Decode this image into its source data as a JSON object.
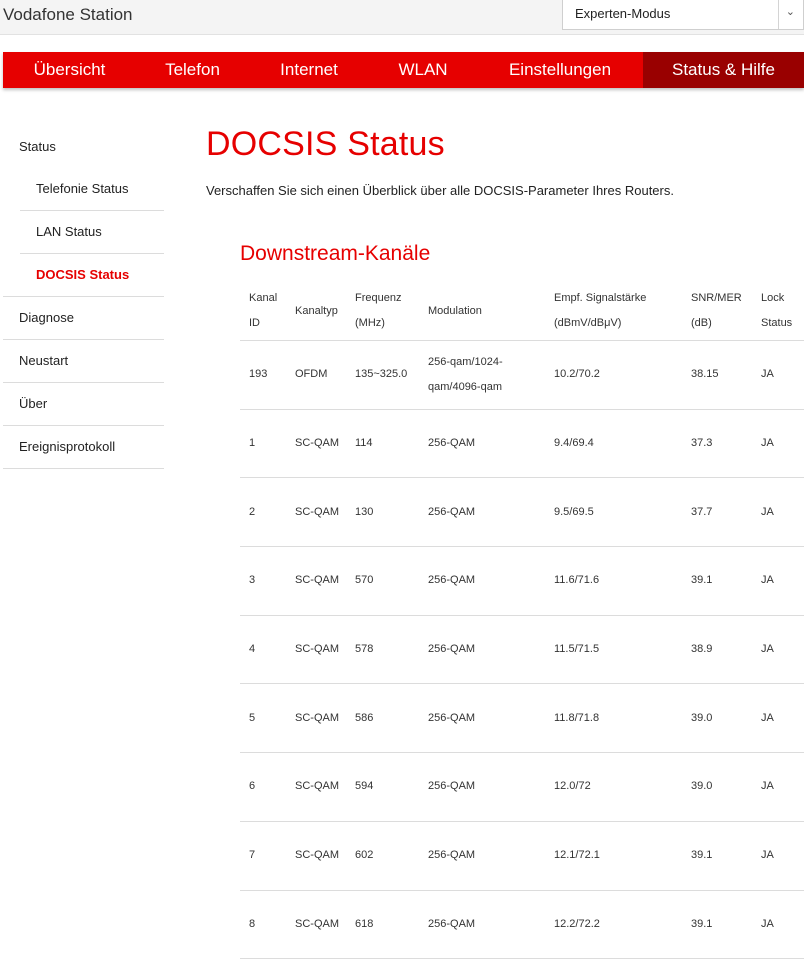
{
  "app": {
    "title": "Vodafone Station"
  },
  "mode_select": {
    "value": "Experten-Modus"
  },
  "nav": {
    "items": [
      {
        "label": "Übersicht"
      },
      {
        "label": "Telefon"
      },
      {
        "label": "Internet"
      },
      {
        "label": "WLAN"
      },
      {
        "label": "Einstellungen"
      },
      {
        "label": "Status & Hilfe",
        "active": true
      }
    ]
  },
  "sidebar": {
    "items": [
      {
        "label": "Status"
      },
      {
        "label": "Telefonie Status"
      },
      {
        "label": "LAN Status"
      },
      {
        "label": "DOCSIS Status",
        "active": true
      },
      {
        "label": "Diagnose"
      },
      {
        "label": "Neustart"
      },
      {
        "label": "Über"
      },
      {
        "label": "Ereignisprotokoll"
      }
    ]
  },
  "main": {
    "title": "DOCSIS Status",
    "intro": "Verschaffen Sie sich einen Überblick über alle DOCSIS-Parameter Ihres Routers.",
    "section_title": "Downstream-Kanäle"
  },
  "table": {
    "headers": [
      "Kanal ID",
      "Kanaltyp",
      "Frequenz (MHz)",
      "Modulation",
      "Empf. Signalstärke (dBmV/dBμV)",
      "SNR/MER (dB)",
      "Lock Status"
    ],
    "rows": [
      [
        "193",
        "OFDM",
        "135~325.0",
        "256-qam/1024-qam/4096-qam",
        "10.2/70.2",
        "38.15",
        "JA"
      ],
      [
        "1",
        "SC-QAM",
        "114",
        "256-QAM",
        "9.4/69.4",
        "37.3",
        "JA"
      ],
      [
        "2",
        "SC-QAM",
        "130",
        "256-QAM",
        "9.5/69.5",
        "37.7",
        "JA"
      ],
      [
        "3",
        "SC-QAM",
        "570",
        "256-QAM",
        "11.6/71.6",
        "39.1",
        "JA"
      ],
      [
        "4",
        "SC-QAM",
        "578",
        "256-QAM",
        "11.5/71.5",
        "38.9",
        "JA"
      ],
      [
        "5",
        "SC-QAM",
        "586",
        "256-QAM",
        "11.8/71.8",
        "39.0",
        "JA"
      ],
      [
        "6",
        "SC-QAM",
        "594",
        "256-QAM",
        "12.0/72",
        "39.0",
        "JA"
      ],
      [
        "7",
        "SC-QAM",
        "602",
        "256-QAM",
        "12.1/72.1",
        "39.1",
        "JA"
      ],
      [
        "8",
        "SC-QAM",
        "618",
        "256-QAM",
        "12.2/72.2",
        "39.1",
        "JA"
      ]
    ]
  },
  "colors": {
    "brand": "#e60000",
    "nav_active": "#990000"
  }
}
